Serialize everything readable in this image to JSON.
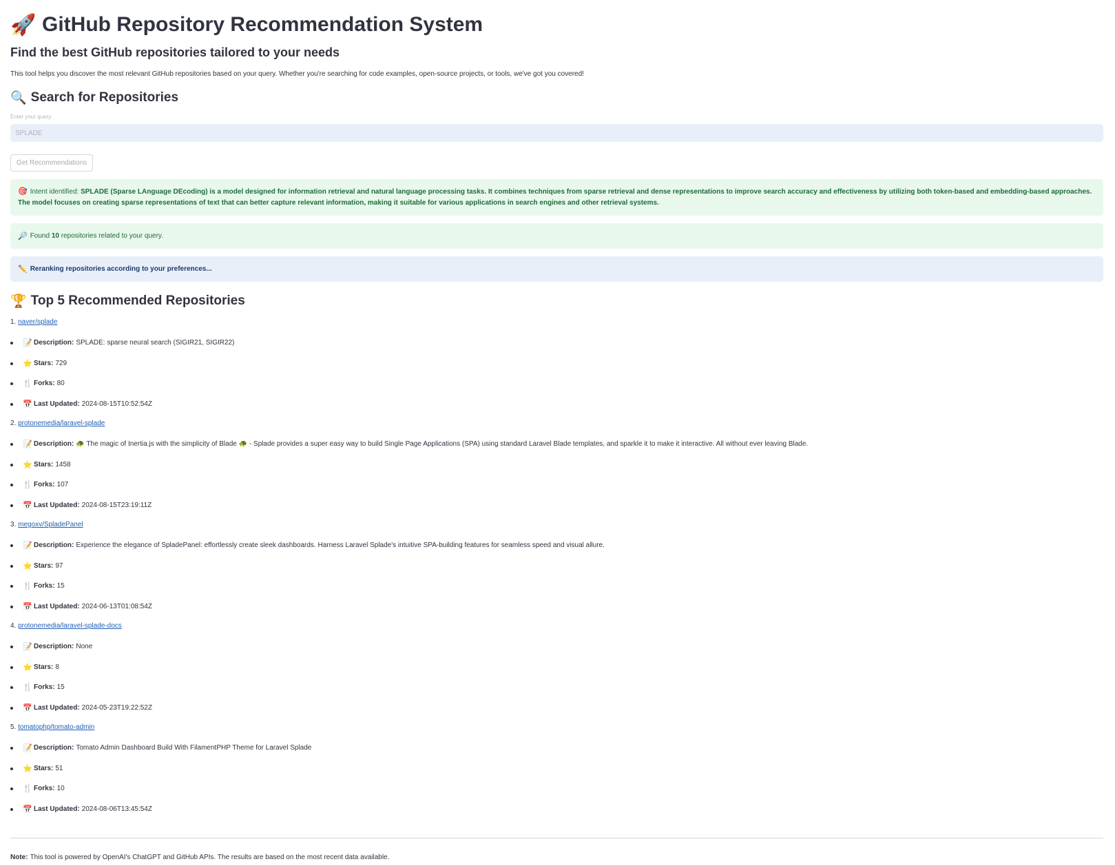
{
  "header": {
    "title": "GitHub Repository Recommendation System",
    "title_icon": "rocket-icon",
    "subtitle": "Find the best GitHub repositories tailored to your needs",
    "intro": "This tool helps you discover the most relevant GitHub repositories based on your query. Whether you're searching for code examples, open-source projects, or tools, we've got you covered!"
  },
  "search": {
    "heading": "Search for Repositories",
    "heading_icon": "magnifier-icon",
    "label": "Enter your query:",
    "value": "SPLADE",
    "button_label": "Get Recommendations"
  },
  "alerts": {
    "intent_label": "Intent identified:",
    "intent_text": "SPLADE (Sparse LAnguage DEcoding) is a model designed for information retrieval and natural language processing tasks. It combines techniques from sparse retrieval and dense representations to improve search accuracy and effectiveness by utilizing both token-based and embedding-based approaches. The model focuses on creating sparse representations of text that can better capture relevant information, making it suitable for various applications in search engines and other retrieval systems.",
    "found_prefix": "Found",
    "found_count": "10",
    "found_suffix": "repositories related to your query.",
    "rerank_text": "Reranking repositories according to your preferences..."
  },
  "results": {
    "heading": "Top 5 Recommended Repositories",
    "heading_icon": "trophy-icon",
    "labels": {
      "description": "Description:",
      "stars": "Stars:",
      "forks": "Forks:",
      "updated": "Last Updated:"
    },
    "repos": [
      {
        "rank": "1.",
        "name": "naver/splade",
        "description": "SPLADE: sparse neural search (SIGIR21, SIGIR22)",
        "stars": "729",
        "forks": "80",
        "updated": "2024-08-15T10:52:54Z"
      },
      {
        "rank": "2.",
        "name": "protonemedia/laravel-splade",
        "description": "🐢 The magic of Inertia.js with the simplicity of Blade 🐢 - Splade provides a super easy way to build Single Page Applications (SPA) using standard Laravel Blade templates, and sparkle it to make it interactive. All without ever leaving Blade.",
        "stars": "1458",
        "forks": "107",
        "updated": "2024-08-15T23:19:11Z"
      },
      {
        "rank": "3.",
        "name": "megoxv/SpladePanel",
        "description": "Experience the elegance of SpladePanel: effortlessly create sleek dashboards. Harness Laravel Splade's intuitive SPA-building features for seamless speed and visual allure.",
        "stars": "97",
        "forks": "15",
        "updated": "2024-06-13T01:08:54Z"
      },
      {
        "rank": "4.",
        "name": "protonemedia/laravel-splade-docs",
        "description": "None",
        "stars": "8",
        "forks": "15",
        "updated": "2024-05-23T19:22:52Z"
      },
      {
        "rank": "5.",
        "name": "tomatophp/tomato-admin",
        "description": "Tomato Admin Dashboard Build With FilamentPHP Theme for Laravel Splade",
        "stars": "51",
        "forks": "10",
        "updated": "2024-08-06T13:45:54Z"
      }
    ]
  },
  "footer": {
    "note_label": "Note:",
    "note_text": "This tool is powered by OpenAI's ChatGPT and GitHub APIs. The results are based on the most recent data available."
  },
  "colors": {
    "link": "#1f5fb5",
    "success_bg": "#e9f8ec",
    "success_text": "#1d6b39",
    "info_bg": "#e8eff9",
    "info_text": "#1e3a6b",
    "text": "#31333f"
  }
}
